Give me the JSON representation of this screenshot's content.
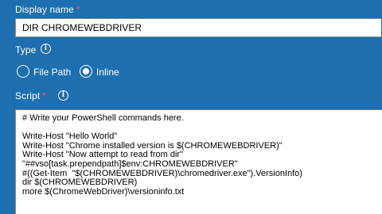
{
  "display_name": {
    "label": "Display name",
    "required_mark": "*",
    "value": "DIR CHROMEWEBDRIVER"
  },
  "type": {
    "label": "Type",
    "info_icon": "info-icon",
    "options": [
      {
        "label": "File Path",
        "selected": false
      },
      {
        "label": "Inline",
        "selected": true
      }
    ]
  },
  "script": {
    "label": "Script",
    "required_mark": "*",
    "info_icon": "info-icon",
    "lines": [
      "# Write your PowerShell commands here.",
      "",
      "Write-Host \"Hello World\"",
      "Write-Host \"Chrome installed version is $(CHROMEWEBDRIVER)\"",
      "Write-Host \"Now attempt to read from dir\"",
      "\"##vso[task.prependpath]$env:CHROMEWEBDRIVER\"",
      "#((Get-Item  \"$(CHROMEWEBDRIVER)\\chromedriver.exe\").VersionInfo)",
      "dir $(CHROMEWEBDRIVER)",
      "more $(ChromeWebDriver)\\versioninfo.txt"
    ]
  },
  "colors": {
    "background": "#1e6fb0",
    "required": "#ff4d4d",
    "input_background": "#ffffff"
  }
}
